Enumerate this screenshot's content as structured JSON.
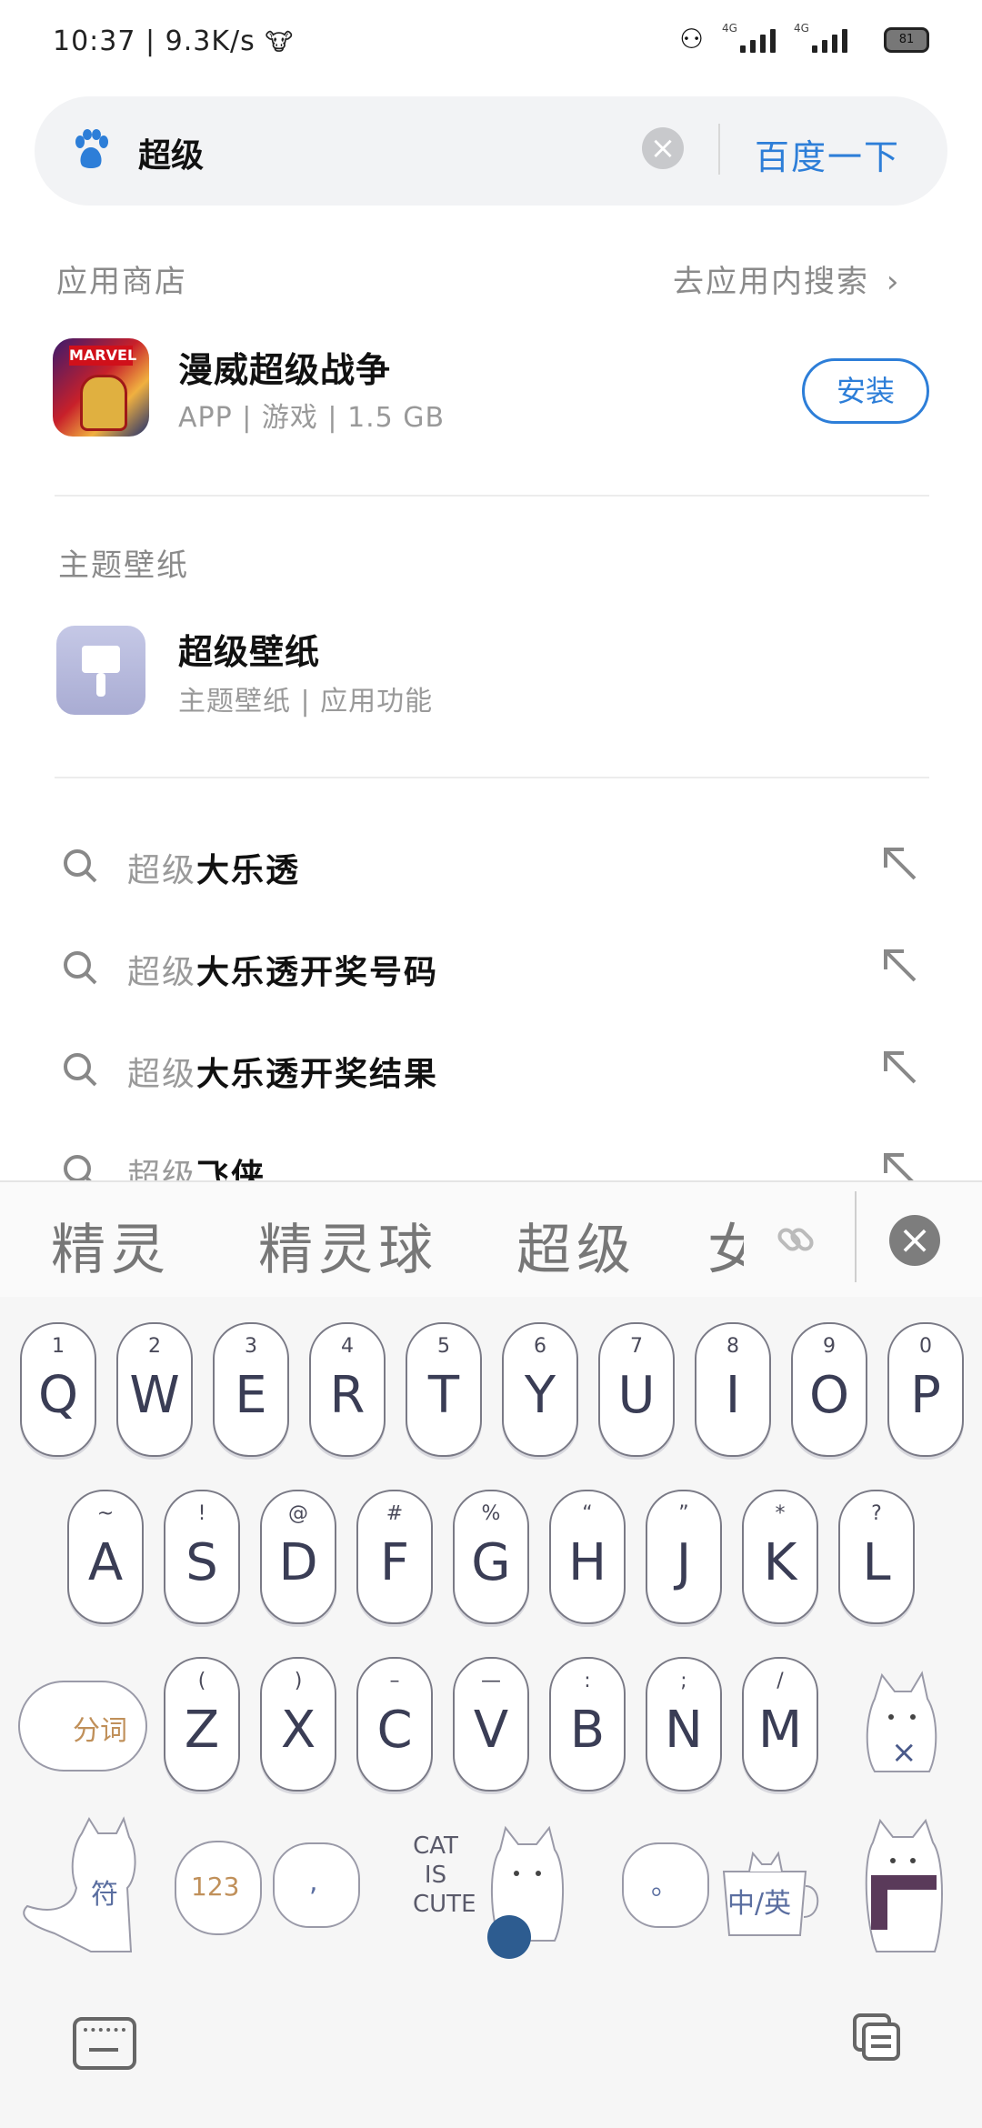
{
  "status": {
    "time": "10:37",
    "speed": "9.3K/s",
    "net1": "4G",
    "net2": "4G",
    "battery": "81"
  },
  "search": {
    "query": "超级",
    "submit_label": "百度一下"
  },
  "app_store": {
    "title": "应用商店",
    "link": "去应用内搜索",
    "app": {
      "name": "漫威超级战争",
      "meta": "APP | 游戏 | 1.5 GB",
      "icon_text": "MARVEL",
      "install_label": "安装"
    }
  },
  "theme": {
    "title": "主题壁纸",
    "item": {
      "name": "超级壁纸",
      "meta": "主题壁纸 | 应用功能"
    }
  },
  "suggestions": [
    {
      "prefix": "超级",
      "rest": "大乐透"
    },
    {
      "prefix": "超级",
      "rest": "大乐透开奖号码"
    },
    {
      "prefix": "超级",
      "rest": "大乐透开奖结果"
    },
    {
      "prefix": "超级",
      "rest": "飞侠"
    }
  ],
  "candidates": [
    "精灵",
    "精灵球",
    "超级",
    "女"
  ],
  "keyboard": {
    "row1": [
      {
        "main": "Q",
        "sub": "1"
      },
      {
        "main": "W",
        "sub": "2"
      },
      {
        "main": "E",
        "sub": "3"
      },
      {
        "main": "R",
        "sub": "4"
      },
      {
        "main": "T",
        "sub": "5"
      },
      {
        "main": "Y",
        "sub": "6"
      },
      {
        "main": "U",
        "sub": "7"
      },
      {
        "main": "I",
        "sub": "8"
      },
      {
        "main": "O",
        "sub": "9"
      },
      {
        "main": "P",
        "sub": "0"
      }
    ],
    "row2": [
      {
        "main": "A",
        "sub": "~"
      },
      {
        "main": "S",
        "sub": "!"
      },
      {
        "main": "D",
        "sub": "@"
      },
      {
        "main": "F",
        "sub": "#"
      },
      {
        "main": "G",
        "sub": "%"
      },
      {
        "main": "H",
        "sub": "“"
      },
      {
        "main": "J",
        "sub": "”"
      },
      {
        "main": "K",
        "sub": "*"
      },
      {
        "main": "L",
        "sub": "?"
      }
    ],
    "row3": [
      {
        "main": "Z",
        "sub": "("
      },
      {
        "main": "X",
        "sub": ")"
      },
      {
        "main": "C",
        "sub": "–"
      },
      {
        "main": "V",
        "sub": "—"
      },
      {
        "main": "B",
        "sub": ":"
      },
      {
        "main": "N",
        "sub": ";"
      },
      {
        "main": "M",
        "sub": "/"
      }
    ],
    "segment_label": "分词",
    "symbol_label": "符",
    "num_label": "123",
    "comma_label": ",",
    "space_text": [
      "CAT",
      "IS",
      "CUTE"
    ],
    "period_label": "。",
    "lang_label": "中/英"
  },
  "colors": {
    "accent": "#2d7ed8",
    "key_border": "#7a7a86",
    "key_text": "#3a3d55"
  }
}
